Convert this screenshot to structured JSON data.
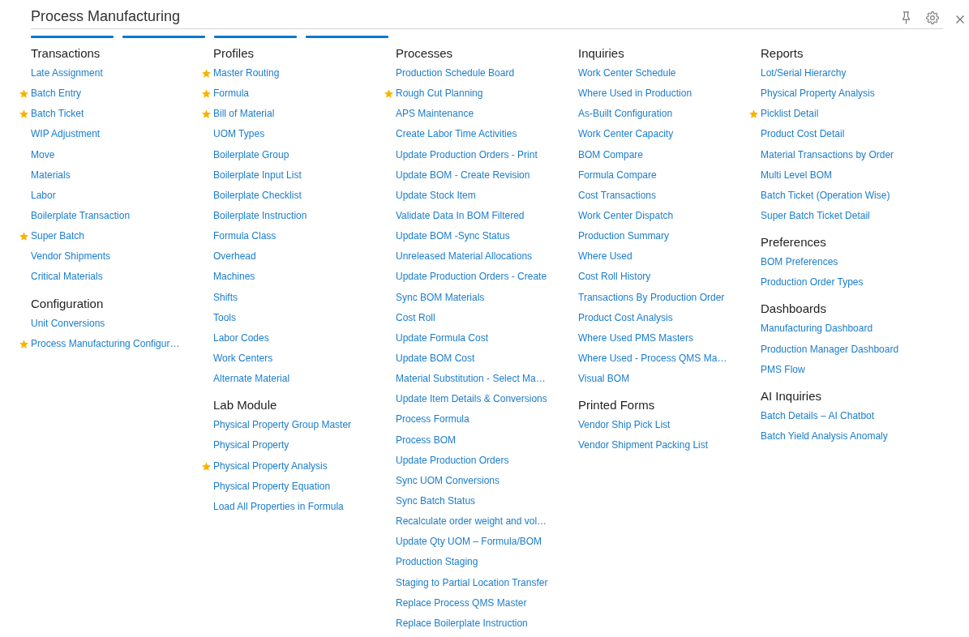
{
  "header": {
    "title": "Process Manufacturing"
  },
  "columns": [
    {
      "sections": [
        {
          "heading": "Transactions",
          "items": [
            {
              "label": "Late Assignment",
              "favorite": false
            },
            {
              "label": "Batch Entry",
              "favorite": true
            },
            {
              "label": "Batch Ticket",
              "favorite": true
            },
            {
              "label": "WIP Adjustment",
              "favorite": false
            },
            {
              "label": "Move",
              "favorite": false
            },
            {
              "label": "Materials",
              "favorite": false
            },
            {
              "label": "Labor",
              "favorite": false
            },
            {
              "label": "Boilerplate Transaction",
              "favorite": false
            },
            {
              "label": "Super Batch",
              "favorite": true
            },
            {
              "label": "Vendor Shipments",
              "favorite": false
            },
            {
              "label": "Critical Materials",
              "favorite": false
            }
          ]
        },
        {
          "heading": "Configuration",
          "items": [
            {
              "label": "Unit Conversions",
              "favorite": false
            },
            {
              "label": "Process Manufacturing Configur…",
              "favorite": true
            }
          ]
        }
      ]
    },
    {
      "sections": [
        {
          "heading": "Profiles",
          "items": [
            {
              "label": "Master Routing",
              "favorite": true
            },
            {
              "label": "Formula",
              "favorite": true
            },
            {
              "label": "Bill of Material",
              "favorite": true
            },
            {
              "label": "UOM Types",
              "favorite": false
            },
            {
              "label": "Boilerplate Group",
              "favorite": false
            },
            {
              "label": "Boilerplate Input List",
              "favorite": false
            },
            {
              "label": "Boilerplate Checklist",
              "favorite": false
            },
            {
              "label": "Boilerplate Instruction",
              "favorite": false
            },
            {
              "label": "Formula Class",
              "favorite": false
            },
            {
              "label": "Overhead",
              "favorite": false
            },
            {
              "label": "Machines",
              "favorite": false
            },
            {
              "label": "Shifts",
              "favorite": false
            },
            {
              "label": "Tools",
              "favorite": false
            },
            {
              "label": "Labor Codes",
              "favorite": false
            },
            {
              "label": "Work Centers",
              "favorite": false
            },
            {
              "label": "Alternate Material",
              "favorite": false
            }
          ]
        },
        {
          "heading": "Lab Module",
          "items": [
            {
              "label": "Physical Property Group Master",
              "favorite": false
            },
            {
              "label": "Physical Property",
              "favorite": false
            },
            {
              "label": "Physical Property Analysis",
              "favorite": true
            },
            {
              "label": "Physical Property Equation",
              "favorite": false
            },
            {
              "label": "Load All Properties in Formula",
              "favorite": false
            }
          ]
        }
      ]
    },
    {
      "sections": [
        {
          "heading": "Processes",
          "items": [
            {
              "label": "Production Schedule Board",
              "favorite": false
            },
            {
              "label": "Rough Cut Planning",
              "favorite": true
            },
            {
              "label": "APS Maintenance",
              "favorite": false
            },
            {
              "label": "Create Labor Time Activities",
              "favorite": false
            },
            {
              "label": "Update Production Orders - Print",
              "favorite": false
            },
            {
              "label": "Update BOM - Create Revision",
              "favorite": false
            },
            {
              "label": "Update Stock Item",
              "favorite": false
            },
            {
              "label": "Validate Data In BOM Filtered",
              "favorite": false
            },
            {
              "label": "Update BOM -Sync Status",
              "favorite": false
            },
            {
              "label": "Unreleased Material Allocations",
              "favorite": false
            },
            {
              "label": "Update Production Orders - Create",
              "favorite": false
            },
            {
              "label": "Sync BOM Materials",
              "favorite": false
            },
            {
              "label": "Cost Roll",
              "favorite": false
            },
            {
              "label": "Update Formula Cost",
              "favorite": false
            },
            {
              "label": "Update BOM Cost",
              "favorite": false
            },
            {
              "label": "Material Substitution - Select Ma…",
              "favorite": false
            },
            {
              "label": "Update Item Details & Conversions",
              "favorite": false
            },
            {
              "label": "Process Formula",
              "favorite": false
            },
            {
              "label": "Process BOM",
              "favorite": false
            },
            {
              "label": "Update Production Orders",
              "favorite": false
            },
            {
              "label": "Sync UOM Conversions",
              "favorite": false
            },
            {
              "label": "Sync Batch Status",
              "favorite": false
            },
            {
              "label": "Recalculate order weight and vol…",
              "favorite": false
            },
            {
              "label": "Update Qty UOM – Formula/BOM",
              "favorite": false
            },
            {
              "label": "Production Staging",
              "favorite": false
            },
            {
              "label": "Staging to Partial Location Transfer",
              "favorite": false
            },
            {
              "label": "Replace Process QMS Master",
              "favorite": false
            },
            {
              "label": "Replace Boilerplate Instruction",
              "favorite": false
            }
          ]
        }
      ]
    },
    {
      "sections": [
        {
          "heading": "Inquiries",
          "items": [
            {
              "label": "Work Center Schedule",
              "favorite": false
            },
            {
              "label": "Where Used in Production",
              "favorite": false
            },
            {
              "label": "As-Built Configuration",
              "favorite": false
            },
            {
              "label": "Work Center Capacity",
              "favorite": false
            },
            {
              "label": "BOM Compare",
              "favorite": false
            },
            {
              "label": "Formula Compare",
              "favorite": false
            },
            {
              "label": "Cost Transactions",
              "favorite": false
            },
            {
              "label": "Work Center Dispatch",
              "favorite": false
            },
            {
              "label": "Production Summary",
              "favorite": false
            },
            {
              "label": "Where Used",
              "favorite": false
            },
            {
              "label": "Cost Roll History",
              "favorite": false
            },
            {
              "label": "Transactions By Production Order",
              "favorite": false
            },
            {
              "label": "Product Cost Analysis",
              "favorite": false
            },
            {
              "label": "Where Used PMS Masters",
              "favorite": false
            },
            {
              "label": "Where Used - Process QMS Ma…",
              "favorite": false
            },
            {
              "label": "Visual BOM",
              "favorite": false
            }
          ]
        },
        {
          "heading": "Printed Forms",
          "items": [
            {
              "label": "Vendor Ship Pick List",
              "favorite": false
            },
            {
              "label": "Vendor Shipment Packing List",
              "favorite": false
            }
          ]
        }
      ]
    },
    {
      "sections": [
        {
          "heading": "Reports",
          "items": [
            {
              "label": "Lot/Serial Hierarchy",
              "favorite": false
            },
            {
              "label": "Physical Property Analysis",
              "favorite": false
            },
            {
              "label": "Picklist Detail",
              "favorite": true
            },
            {
              "label": "Product Cost Detail",
              "favorite": false
            },
            {
              "label": "Material Transactions by Order",
              "favorite": false
            },
            {
              "label": "Multi Level BOM",
              "favorite": false
            },
            {
              "label": "Batch Ticket (Operation Wise)",
              "favorite": false
            },
            {
              "label": "Super Batch Ticket Detail",
              "favorite": false
            }
          ]
        },
        {
          "heading": "Preferences",
          "items": [
            {
              "label": "BOM Preferences",
              "favorite": false
            },
            {
              "label": "Production Order Types",
              "favorite": false
            }
          ]
        },
        {
          "heading": "Dashboards",
          "items": [
            {
              "label": "Manufacturing Dashboard",
              "favorite": false
            },
            {
              "label": "Production Manager Dashboard",
              "favorite": false
            },
            {
              "label": "PMS Flow",
              "favorite": false
            }
          ]
        },
        {
          "heading": "AI Inquiries",
          "items": [
            {
              "label": "Batch Details – AI Chatbot",
              "favorite": false
            },
            {
              "label": "Batch Yield Analysis Anomaly",
              "favorite": false
            }
          ]
        }
      ]
    }
  ]
}
